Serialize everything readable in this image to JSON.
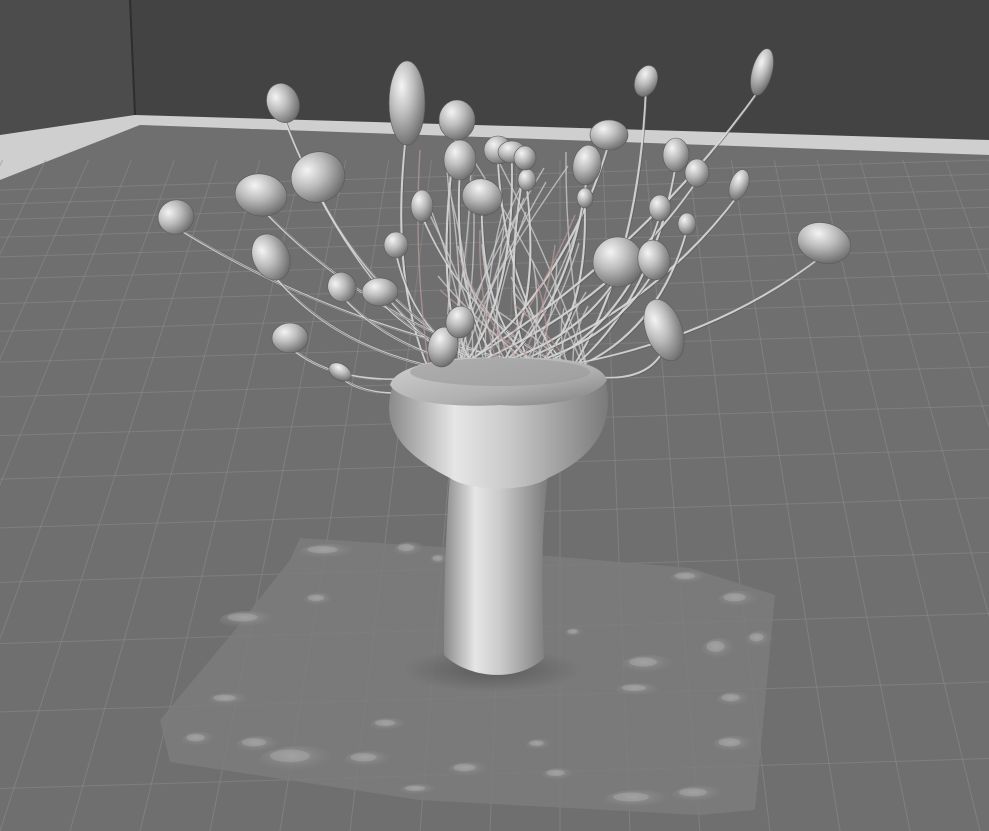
{
  "viewport": {
    "background_color": "#4a4a4a",
    "back_wall_color": "#444444",
    "left_wall_color": "#4d4d4d",
    "floor_color": "#6f6f6f",
    "grid_color": "#8e8e8e",
    "baseboard_color": "#cfcfcf",
    "mesh_color": "#b9b9b9",
    "mesh_highlight": "#eeeeee",
    "mesh_shadow": "#5c5c5c",
    "stem_color": "#d8d8d8",
    "grid_visible": true
  },
  "scene": {
    "objects": [
      {
        "name": "vase-mesh",
        "kind": "sculpted-vase"
      },
      {
        "name": "branches-mesh",
        "kind": "thin-stems"
      },
      {
        "name": "leaf-blobs-mesh",
        "kind": "leaf-blobs"
      },
      {
        "name": "ground-patch-mesh",
        "kind": "displaced-ground-plane"
      }
    ]
  }
}
